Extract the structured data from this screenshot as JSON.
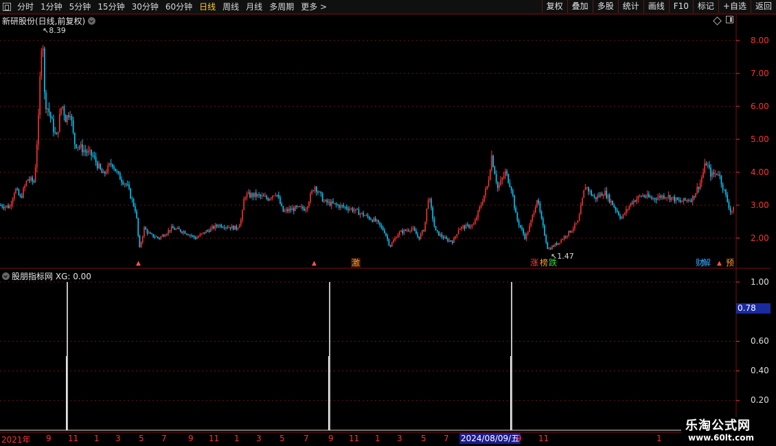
{
  "toolbar": {
    "periods": [
      "分时",
      "1分钟",
      "5分钟",
      "15分钟",
      "30分钟",
      "60分钟",
      "日线",
      "周线",
      "月线",
      "多周期",
      "更多"
    ],
    "active_period": "日线",
    "more_arrow": ">",
    "buttons": [
      "复权",
      "叠加",
      "多股",
      "统计",
      "画线",
      "F10",
      "标记",
      "+自选",
      "返回"
    ]
  },
  "main_chart": {
    "title": "新研股份(日线,前复权)",
    "high_label": "8.39",
    "low_label": "1.47",
    "y_ticks": [
      "8.00",
      "7.00",
      "6.00",
      "5.00",
      "4.00",
      "3.00",
      "2.00"
    ],
    "badges": [
      {
        "text": "激",
        "color": "#ff9a3a"
      },
      {
        "text": "涨",
        "color": "#ff4040"
      },
      {
        "text": "榜",
        "color": "#ff9a3a"
      },
      {
        "text": "跌",
        "color": "#33dd33"
      },
      {
        "text": "财",
        "color": "#33aaff"
      },
      {
        "text": "解",
        "color": "#33aaff"
      },
      {
        "text": "预",
        "color": "#ff9a3a"
      }
    ],
    "colors": {
      "up": "#ff3333",
      "down": "#00ccff",
      "grid": "#7a1010",
      "axis": "#ff3030"
    }
  },
  "indicator": {
    "name": "股朋指标网",
    "formula": "XG: 0.00",
    "y_ticks": [
      "1.00",
      "0.60",
      "0.40",
      "0.20"
    ],
    "current_value": "0.78"
  },
  "date_axis": {
    "labels": [
      "2021年",
      "9",
      "11",
      "1",
      "3",
      "5",
      "7",
      "9",
      "11",
      "1",
      "3",
      "5",
      "7",
      "9",
      "11",
      "1",
      "3",
      "5",
      "7",
      "9",
      "11",
      "1"
    ],
    "highlighted": "2024/08/09/五"
  },
  "watermark": {
    "title": "乐淘公式网",
    "url": "www.60lt.com"
  }
}
